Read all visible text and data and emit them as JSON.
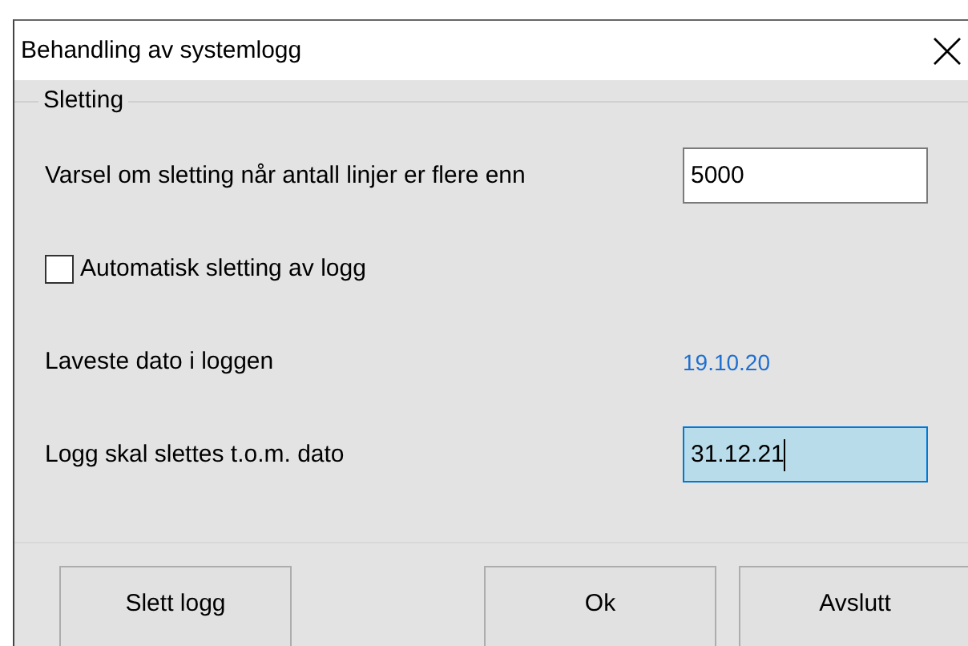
{
  "window": {
    "title": "Behandling av systemlogg"
  },
  "group": {
    "title": "Sletting"
  },
  "fields": [
    {
      "kind": "input",
      "label": "Varsel om sletting når antall linjer er flere enn",
      "value": "5000",
      "focused": false
    },
    {
      "kind": "checkbox",
      "label": "Automatisk sletting av logg",
      "checked": false
    },
    {
      "kind": "readout",
      "label": "Laveste dato i loggen",
      "value": "19.10.20"
    },
    {
      "kind": "input",
      "label": "Logg skal slettes t.o.m. dato",
      "value": "31.12.21",
      "focused": true
    }
  ],
  "buttons": [
    {
      "label": "Slett logg"
    },
    {
      "label": "Ok"
    },
    {
      "label": "Avslutt"
    }
  ]
}
